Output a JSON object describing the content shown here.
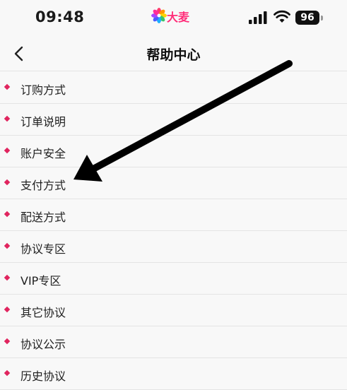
{
  "status_bar": {
    "time": "09:48",
    "app_logo_text": "大麦",
    "battery": "96",
    "icons": [
      "signal-icon",
      "wifi-icon",
      "battery-icon"
    ]
  },
  "nav": {
    "title": "帮助中心",
    "back_icon": "chevron-left-icon"
  },
  "help_items": [
    {
      "label": "订购方式"
    },
    {
      "label": "订单说明"
    },
    {
      "label": "账户安全"
    },
    {
      "label": "支付方式"
    },
    {
      "label": "配送方式"
    },
    {
      "label": "协议专区"
    },
    {
      "label": "VIP专区"
    },
    {
      "label": "其它协议"
    },
    {
      "label": "协议公示"
    },
    {
      "label": "历史协议"
    }
  ],
  "colors": {
    "bullet": "#e0245e",
    "brand": "#ff2d79",
    "background": "#f8f8f8",
    "divider": "#e4e4e4"
  },
  "annotation": {
    "type": "arrow",
    "points_to": "支付方式",
    "color": "#000000"
  }
}
